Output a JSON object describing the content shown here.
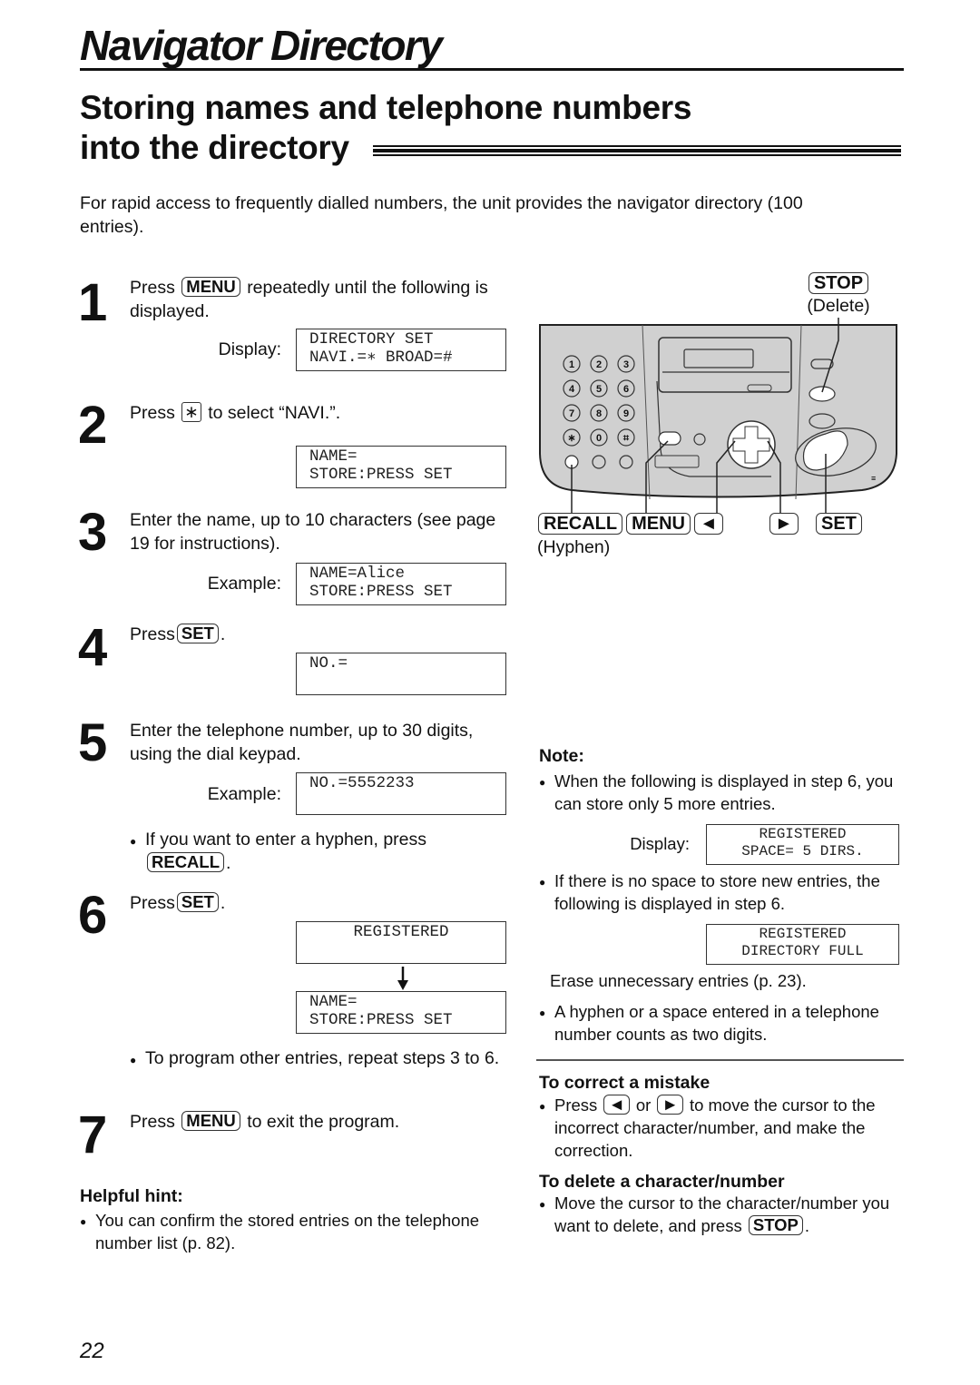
{
  "page_title": "Navigator Directory",
  "section_title_line1": "Storing names and telephone numbers",
  "section_title_line2": "into the directory",
  "intro": "For rapid access to frequently dialled numbers, the unit provides the navigator directory (100 entries).",
  "steps": [
    {
      "number": "1",
      "text_before": "Press",
      "key": "MENU",
      "text_after": "repeatedly until the following is displayed.",
      "display_label": "Display:",
      "display_lines": [
        "DIRECTORY SET",
        "NAVI.=∗ BROAD=#"
      ]
    },
    {
      "number": "2",
      "text_before": "Press",
      "key": "∗",
      "text_after": "to select “NAVI.”.",
      "display_lines": [
        "NAME=",
        "STORE:PRESS SET"
      ]
    },
    {
      "number": "3",
      "text": "Enter the name, up to 10 characters (see page 19 for instructions).",
      "display_label": "Example:",
      "display_lines": [
        "NAME=Alice",
        "STORE:PRESS SET"
      ]
    },
    {
      "number": "4",
      "text_before": "Press",
      "key": "SET",
      "text_after": ".",
      "display_lines": [
        "NO.=",
        ""
      ]
    },
    {
      "number": "5",
      "text": "Enter the telephone number, up to 30 digits, using the dial keypad.",
      "display_label": "Example:",
      "display_lines": [
        "NO.=5552233",
        ""
      ],
      "bullet_before": "If you want to enter a hyphen, press",
      "bullet_key": "RECALL",
      "bullet_after": "."
    },
    {
      "number": "6",
      "text_before": "Press",
      "key": "SET",
      "text_after": ".",
      "display_lines": [
        "REGISTERED",
        ""
      ],
      "display2_lines": [
        "NAME=",
        "STORE:PRESS SET"
      ],
      "bullet": "To program other entries, repeat steps 3 to 6."
    },
    {
      "number": "7",
      "text_before": "Press",
      "key": "MENU",
      "text_after": "to exit the program."
    }
  ],
  "helpful_hint": {
    "heading": "Helpful hint:",
    "bullet": "You can confirm the stored entries on the telephone number list (p. 82)."
  },
  "device": {
    "stop_key": "STOP",
    "stop_caption": "(Delete)",
    "recall_key": "RECALL",
    "recall_caption": "(Hyphen)",
    "menu_key": "MENU",
    "left_key": "◄",
    "right_key": "►",
    "set_key": "SET",
    "keypad": [
      "1",
      "2",
      "3",
      "4",
      "5",
      "6",
      "7",
      "8",
      "9",
      "∗",
      "0",
      "⌗"
    ]
  },
  "note": {
    "heading": "Note:",
    "bullet1": "When the following is displayed in step 6, you can store only 5 more entries.",
    "display_label": "Display:",
    "display1_lines": [
      "REGISTERED",
      "SPACE= 5 DIRS."
    ],
    "bullet2": "If there is no space to store new entries, the following is displayed in step 6.",
    "display2_lines": [
      "REGISTERED",
      "DIRECTORY FULL"
    ],
    "erase_text": "Erase unnecessary entries (p. 23).",
    "bullet3": "A hyphen or a space entered in a telephone number counts as two digits."
  },
  "correct_mistake": {
    "heading": "To correct a mistake",
    "text_before": "Press",
    "key_left": "◄",
    "or": "or",
    "key_right": "►",
    "text_after": "to move the cursor to the incorrect character/number, and make the correction."
  },
  "delete_char": {
    "heading": "To delete a character/number",
    "text_before": "Move the cursor to the character/number you want to delete, and press",
    "key": "STOP",
    "text_after": "."
  },
  "page_number": "22"
}
